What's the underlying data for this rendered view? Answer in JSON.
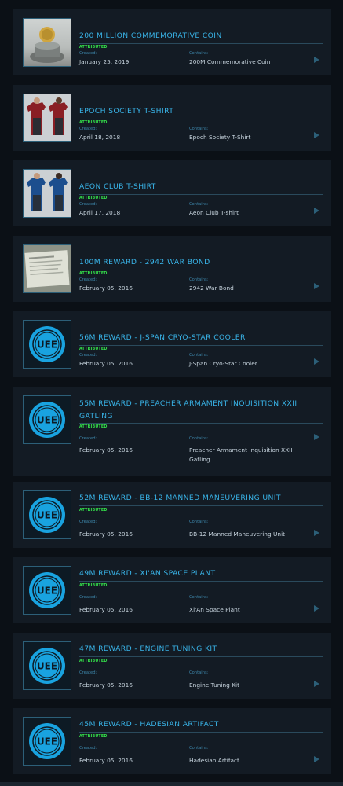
{
  "created_label": "Created:",
  "contains_label": "Contains:",
  "attributed_label": "ATTRIBUTED",
  "items": [
    {
      "title": "200 MILLION COMMEMORATIVE COIN",
      "created": "January 25, 2019",
      "contains": "200M Commemorative Coin",
      "thumb": "coin-photo"
    },
    {
      "title": "EPOCH SOCIETY T-SHIRT",
      "created": "April 18, 2018",
      "contains": "Epoch Society T-Shirt",
      "thumb": "red-tshirt"
    },
    {
      "title": "AEON CLUB T-SHIRT",
      "created": "April 17, 2018",
      "contains": "Aeon Club T-shirt",
      "thumb": "blue-tshirt"
    },
    {
      "title": "100M REWARD - 2942 WAR BOND",
      "created": "February 05, 2016",
      "contains": "2942 War Bond",
      "thumb": "war-bond-certificate"
    },
    {
      "title": "56M REWARD - J-SPAN CRYO-STAR COOLER",
      "created": "February 05, 2016",
      "contains": "J-Span Cryo-Star Cooler",
      "thumb": "uee-logo"
    },
    {
      "title": "55M REWARD - PREACHER ARMAMENT INQUISITION XXII GATLING",
      "created": "February 05, 2016",
      "contains": "Preacher Armament Inquisition XXII Gatling",
      "thumb": "uee-logo"
    },
    {
      "title": "52M REWARD - BB-12 MANNED MANEUVERING UNIT",
      "created": "February 05, 2016",
      "contains": "BB-12 Manned Maneuvering Unit",
      "thumb": "uee-logo"
    },
    {
      "title": "49M REWARD - XI'AN SPACE PLANT",
      "created": "February 05, 2016",
      "contains": "Xi'An Space Plant",
      "thumb": "uee-logo"
    },
    {
      "title": "47M REWARD - ENGINE TUNING KIT",
      "created": "February 05, 2016",
      "contains": "Engine Tuning Kit",
      "thumb": "uee-logo"
    },
    {
      "title": "45M REWARD - HADESIAN ARTIFACT",
      "created": "February 05, 2016",
      "contains": "Hadesian Artifact",
      "thumb": "uee-logo"
    }
  ]
}
